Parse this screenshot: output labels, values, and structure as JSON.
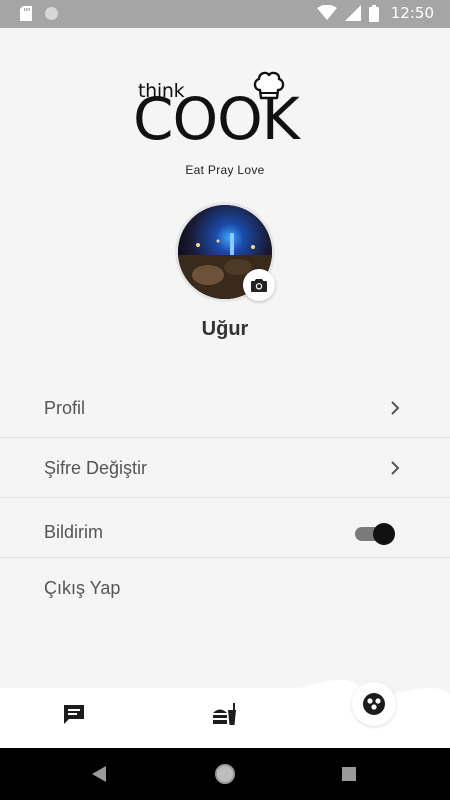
{
  "status_bar": {
    "time": "12:50"
  },
  "logo": {
    "small": "think",
    "big": "COOK",
    "tagline": "Eat Pray Love"
  },
  "profile": {
    "username": "Uğur"
  },
  "menu": {
    "items": [
      {
        "label": "Profil",
        "trailing": "chevron-right-icon"
      },
      {
        "label": "Şifre Değiştir",
        "trailing": "chevron-right-icon"
      },
      {
        "label": "Bildirim",
        "trailing": "toggle",
        "toggle_on": true
      },
      {
        "label": "Çıkış Yap",
        "trailing": "none"
      }
    ]
  },
  "bottom_nav": {
    "items": [
      {
        "icon": "chat-icon"
      },
      {
        "icon": "food-icon"
      },
      {
        "icon": "community-icon",
        "active": true
      }
    ]
  },
  "colors": {
    "status_bar": "#a5a5a5",
    "background": "#f5f5f5",
    "text": "#555555",
    "toggle_knob": "#111111"
  }
}
